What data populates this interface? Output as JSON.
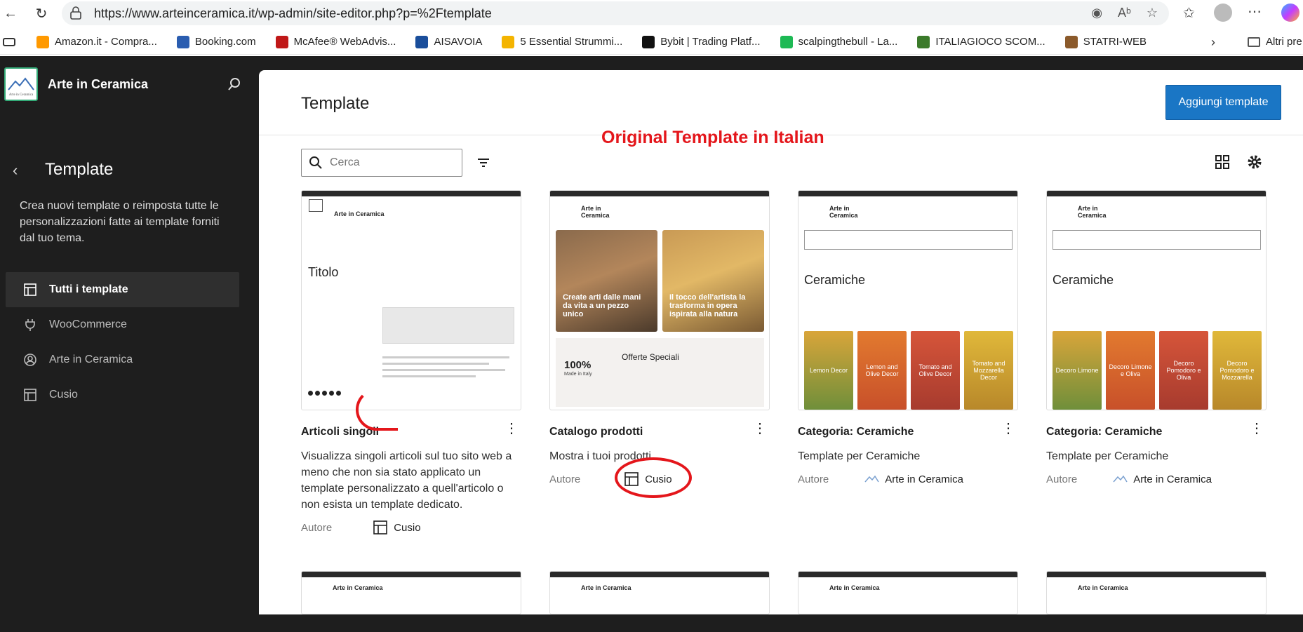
{
  "browser": {
    "url": "https://www.arteinceramica.it/wp-admin/site-editor.php?p=%2Ftemplate"
  },
  "bookmarks": [
    {
      "label": "Amazon.it - Compra...",
      "color": "#ff9900"
    },
    {
      "label": "Booking.com",
      "color": "#2a5db0"
    },
    {
      "label": "McAfee® WebAdvis...",
      "color": "#c01818"
    },
    {
      "label": "AISAVOIA",
      "color": "#1a4e9b"
    },
    {
      "label": "5 Essential Strummi...",
      "color": "#f4b400"
    },
    {
      "label": "Bybit | Trading Platf...",
      "color": "#111111"
    },
    {
      "label": "scalpingthebull - La...",
      "color": "#1db954"
    },
    {
      "label": "ITALIAGIOCO SCOM...",
      "color": "#3b7a2a"
    },
    {
      "label": "STATRI-WEB",
      "color": "#8b5a2b"
    }
  ],
  "bookmarks_more": "Altri pre",
  "sidebar": {
    "site_name": "Arte in Ceramica",
    "section_title": "Template",
    "description": "Crea nuovi template o reimposta tutte le personalizzazioni fatte ai template forniti dal tuo tema.",
    "menu": [
      {
        "label": "Tutti i template",
        "icon": "layout-icon",
        "active": true
      },
      {
        "label": "WooCommerce",
        "icon": "plug-icon",
        "active": false
      },
      {
        "label": "Arte in Ceramica",
        "icon": "user-circle-icon",
        "active": false
      },
      {
        "label": "Cusio",
        "icon": "layout-icon",
        "active": false
      }
    ]
  },
  "main": {
    "title": "Template",
    "add_button": "Aggiungi template",
    "annotation": "Original Template in Italian",
    "search_placeholder": "Cerca",
    "author_label": "Autore",
    "cards": [
      {
        "title": "Articoli singoli",
        "description": "Visualizza singoli articoli sul tuo sito web a meno che non sia stato applicato un template personalizzato a quell'articolo o non esista un template dedicato.",
        "author": "Cusio",
        "author_icon": "layout-icon",
        "thumb_heading": "Titolo",
        "thumb_site": "Arte in Ceramica"
      },
      {
        "title": "Catalogo prodotti",
        "description": "Mostra i tuoi prodotti.",
        "author": "Cusio",
        "author_icon": "layout-icon",
        "thumb_site": "Arte in Ceramica",
        "thumb_caption_1": "Create arti dalle mani da vita a un pezzo unico",
        "thumb_caption_2": "Il tocco dell'artista la trasforma in opera ispirata alla natura",
        "thumb_offer": "Offerte Speciali",
        "thumb_stat": "100%",
        "thumb_stat_sub": "Made in Italy"
      },
      {
        "title": "Categoria: Ceramiche",
        "description": "Template per Ceramiche",
        "author": "Arte in Ceramica",
        "author_icon": "site-logo-icon",
        "thumb_site": "Arte in Ceramica",
        "thumb_heading": "Ceramiche",
        "tiles": [
          "Lemon Decor",
          "Lemon and Olive Decor",
          "Tomato and Olive Decor",
          "Tomato and Mozzarella Decor"
        ]
      },
      {
        "title": "Categoria: Ceramiche",
        "description": "Template per Ceramiche",
        "author": "Arte in Ceramica",
        "author_icon": "site-logo-icon",
        "thumb_site": "Arte in Ceramica",
        "thumb_heading": "Ceramiche",
        "tiles": [
          "Decoro Limone",
          "Decoro Limone e Oliva",
          "Decoro Pomodoro e Oliva",
          "Decoro Pomodoro e Mozzarella"
        ]
      }
    ],
    "bottom_cards": [
      {
        "site": "Arte in Ceramica"
      },
      {
        "site": "Arte in Ceramica"
      },
      {
        "site": "Arte in Ceramica"
      },
      {
        "site": "Arte in Ceramica"
      }
    ]
  },
  "colors": {
    "accent": "#1a76c5",
    "sidebar_bg": "#1e1e1e",
    "annotation": "#e4161b"
  }
}
